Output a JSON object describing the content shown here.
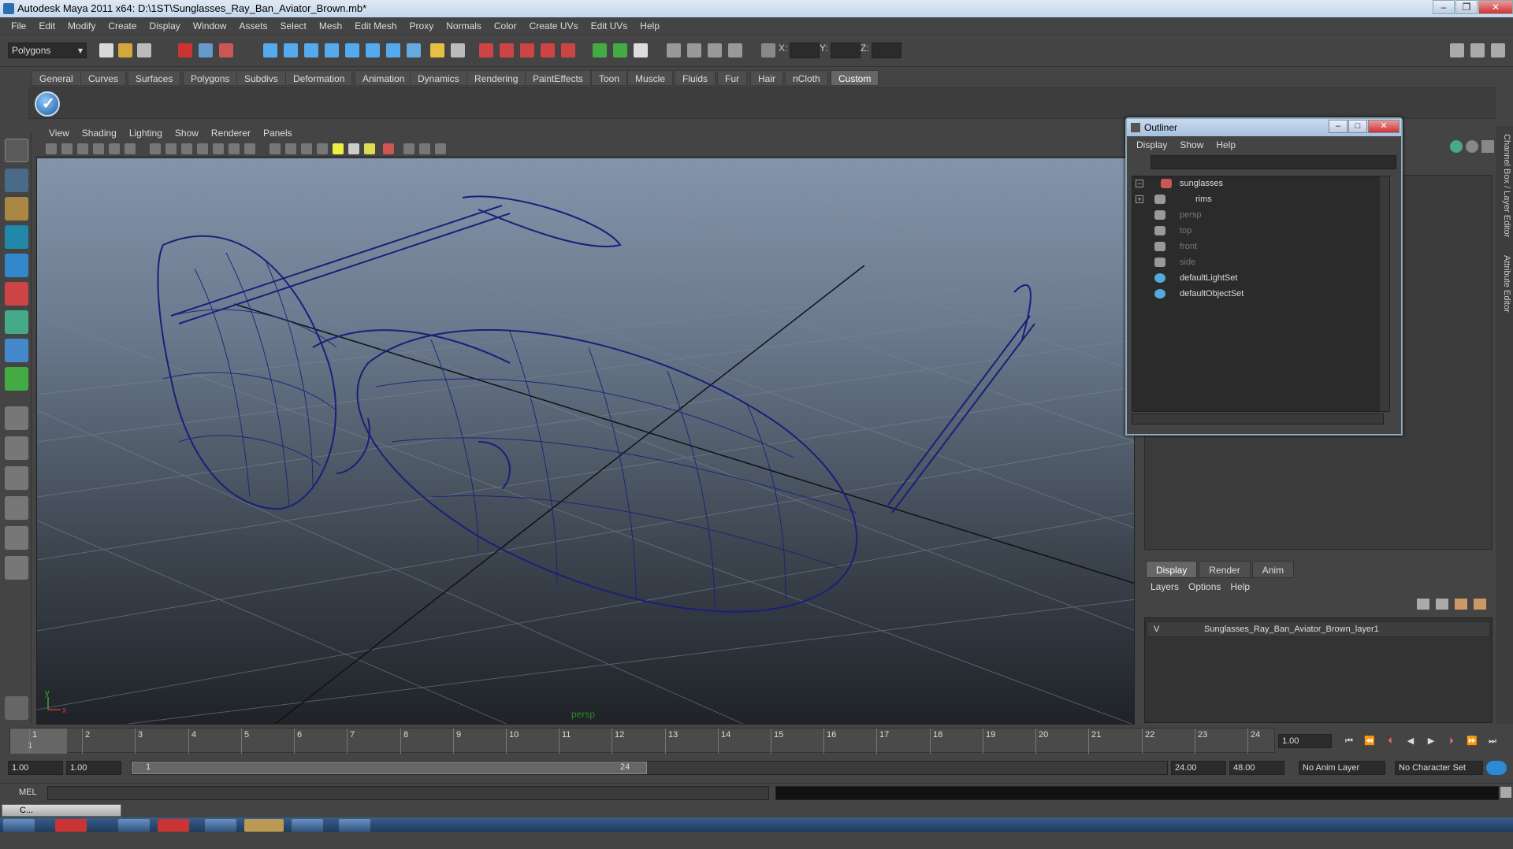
{
  "window": {
    "title": "Autodesk Maya 2011 x64: D:\\1ST\\Sunglasses_Ray_Ban_Aviator_Brown.mb*"
  },
  "menubar": [
    "File",
    "Edit",
    "Modify",
    "Create",
    "Display",
    "Window",
    "Assets",
    "Select",
    "Mesh",
    "Edit Mesh",
    "Proxy",
    "Normals",
    "Color",
    "Create UVs",
    "Edit UVs",
    "Help"
  ],
  "statusline": {
    "mode": "Polygons",
    "x_label": "X:",
    "y_label": "Y:",
    "z_label": "Z:"
  },
  "shelf_tabs": [
    "General",
    "Curves",
    "Surfaces",
    "Polygons",
    "Subdivs",
    "Deformation",
    "Animation",
    "Dynamics",
    "Rendering",
    "PaintEffects",
    "Toon",
    "Muscle",
    "Fluids",
    "Fur",
    "Hair",
    "nCloth",
    "Custom"
  ],
  "active_shelf_tab": "Custom",
  "viewport": {
    "menu": [
      "View",
      "Shading",
      "Lighting",
      "Show",
      "Renderer",
      "Panels"
    ],
    "camera_label": "persp",
    "axis_x": "x",
    "axis_y": "y",
    "wire_color": "#1a1f7a"
  },
  "outliner": {
    "title": "Outliner",
    "menu": [
      "Display",
      "Show",
      "Help"
    ],
    "items": [
      {
        "label": "sunglasses",
        "dim": false,
        "expander": "−"
      },
      {
        "label": "rims",
        "dim": false,
        "expander": "+"
      },
      {
        "label": "persp",
        "dim": true,
        "expander": ""
      },
      {
        "label": "top",
        "dim": true,
        "expander": ""
      },
      {
        "label": "front",
        "dim": true,
        "expander": ""
      },
      {
        "label": "side",
        "dim": true,
        "expander": ""
      },
      {
        "label": "defaultLightSet",
        "dim": false,
        "expander": ""
      },
      {
        "label": "defaultObjectSet",
        "dim": false,
        "expander": ""
      }
    ]
  },
  "side_tabs": {
    "channel_box": "Channel Box / Layer Editor",
    "attribute_editor": "Attribute Editor"
  },
  "layer_editor": {
    "tabs": [
      "Display",
      "Render",
      "Anim"
    ],
    "active_tab": "Display",
    "menu": [
      "Layers",
      "Options",
      "Help"
    ],
    "layer": {
      "visibility": "V",
      "name": "Sunglasses_Ray_Ban_Aviator_Brown_layer1"
    }
  },
  "timeline": {
    "ticks": [
      "1",
      "2",
      "3",
      "4",
      "5",
      "6",
      "7",
      "8",
      "9",
      "10",
      "11",
      "12",
      "13",
      "14",
      "15",
      "16",
      "17",
      "18",
      "19",
      "20",
      "21",
      "22",
      "23",
      "24"
    ],
    "current_frame": "1",
    "current_time_field": "1.00"
  },
  "range": {
    "start": "1.00",
    "anim_start": "1.00",
    "slider_start": "1",
    "slider_end": "24",
    "end": "24.00",
    "anim_end": "48.00",
    "anim_layer": "No Anim Layer",
    "char_set": "No Character Set"
  },
  "cmdline": {
    "label": "MEL"
  },
  "minimized_window": {
    "label": "C..."
  }
}
